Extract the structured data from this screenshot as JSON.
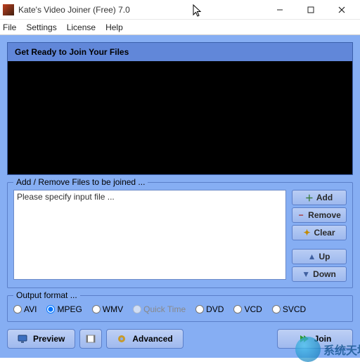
{
  "window": {
    "title": "Kate's Video Joiner (Free) 7.0"
  },
  "menu": {
    "file": "File",
    "settings": "Settings",
    "license": "License",
    "help": "Help"
  },
  "banner": {
    "title": "Get Ready to Join Your Files"
  },
  "files_group": {
    "title": "Add / Remove Files to be joined ...",
    "placeholder": "Please specify input file ..."
  },
  "buttons": {
    "add": "Add",
    "remove": "Remove",
    "clear": "Clear",
    "up": "Up",
    "down": "Down"
  },
  "format_group": {
    "title": "Output format ..."
  },
  "formats": {
    "avi": "AVI",
    "mpeg": "MPEG",
    "wmv": "WMV",
    "quicktime": "Quick Time",
    "dvd": "DVD",
    "vcd": "VCD",
    "svcd": "SVCD",
    "selected": "mpeg"
  },
  "bottom": {
    "preview": "Preview",
    "advanced": "Advanced",
    "join": "Join"
  },
  "watermark": {
    "text": "系统天地"
  }
}
